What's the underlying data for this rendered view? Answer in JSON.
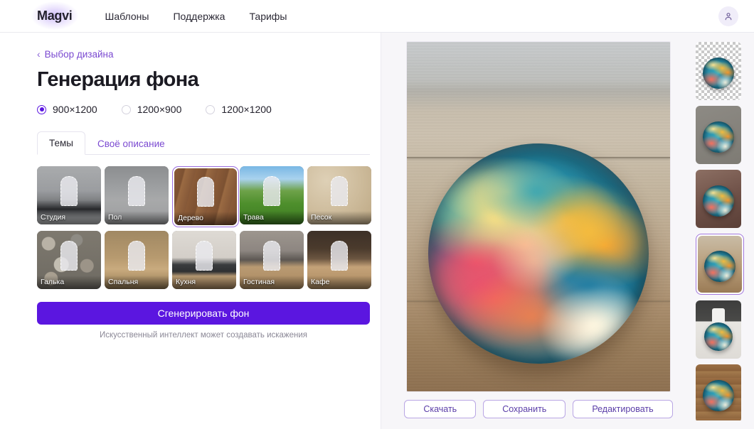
{
  "header": {
    "logo": "Magvi",
    "nav": [
      {
        "label": "Шаблоны"
      },
      {
        "label": "Поддержка"
      },
      {
        "label": "Тарифы"
      }
    ],
    "avatar_icon": "user-icon"
  },
  "left": {
    "breadcrumb": {
      "chevron": "‹",
      "label": "Выбор дизайна"
    },
    "title": "Генерация фона",
    "sizes": [
      {
        "label": "900×1200",
        "selected": true
      },
      {
        "label": "1200×900",
        "selected": false
      },
      {
        "label": "1200×1200",
        "selected": false
      }
    ],
    "tabs": [
      {
        "label": "Темы",
        "active": true
      },
      {
        "label": "Своё описание",
        "active": false
      }
    ],
    "themes": [
      {
        "label": "Студия",
        "selected": false
      },
      {
        "label": "Пол",
        "selected": false
      },
      {
        "label": "Дерево",
        "selected": true
      },
      {
        "label": "Трава",
        "selected": false
      },
      {
        "label": "Песок",
        "selected": false
      },
      {
        "label": "Галька",
        "selected": false
      },
      {
        "label": "Спальня",
        "selected": false
      },
      {
        "label": "Кухня",
        "selected": false
      },
      {
        "label": "Гостиная",
        "selected": false
      },
      {
        "label": "Кафе",
        "selected": false
      }
    ],
    "generate_button": "Сгенерировать фон",
    "disclaimer": "Искусственный интеллект может создавать искажения"
  },
  "right": {
    "preview_alt": "Тарелка с абстрактным разводным узором на деревянном столе",
    "actions": [
      {
        "label": "Скачать"
      },
      {
        "label": "Сохранить"
      },
      {
        "label": "Редактировать"
      }
    ],
    "thumbnails": [
      {
        "kind": "transparent",
        "selected": false
      },
      {
        "kind": "gray",
        "selected": false
      },
      {
        "kind": "warm",
        "selected": false
      },
      {
        "kind": "wood-light",
        "selected": true
      },
      {
        "kind": "split",
        "selected": false
      },
      {
        "kind": "wood-dark",
        "selected": false
      }
    ]
  },
  "colors": {
    "accent": "#5b16e0",
    "link": "#7b4ad1",
    "border": "#e6e4ee",
    "panel_bg": "#f7f6f9",
    "text": "#1b1a22",
    "muted": "#8b8896"
  }
}
